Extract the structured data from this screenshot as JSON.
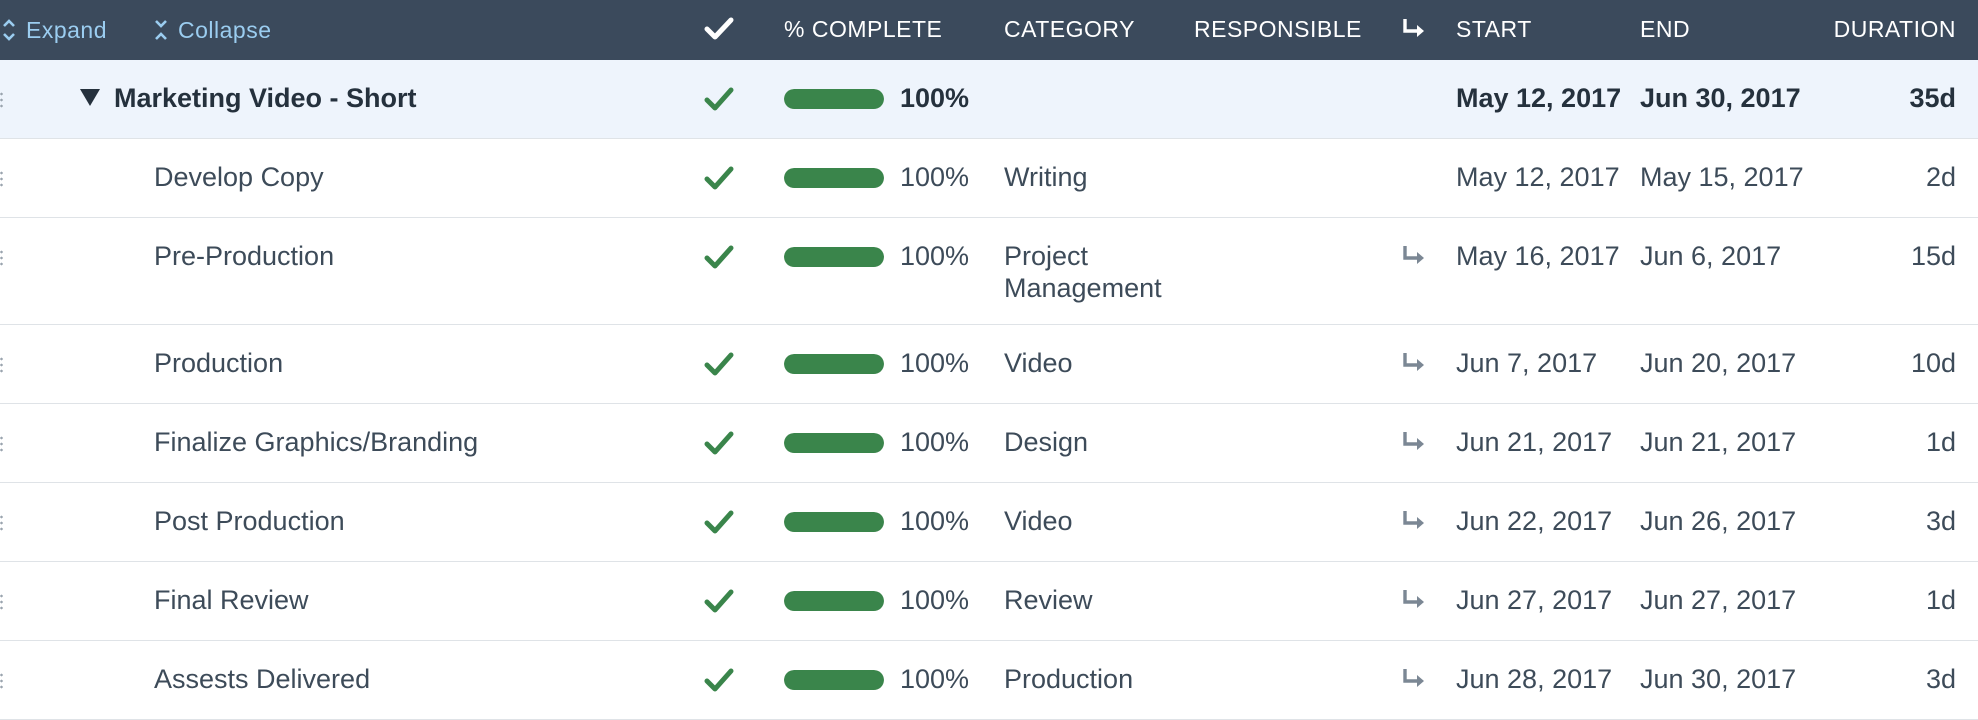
{
  "toolbar": {
    "expand_label": "Expand",
    "collapse_label": "Collapse"
  },
  "columns": {
    "complete": "% COMPLETE",
    "category": "CATEGORY",
    "responsible": "RESPONSIBLE",
    "start": "START",
    "end": "END",
    "duration": "DURATION"
  },
  "icons": {
    "done_check": "check-icon",
    "dependency": "dependency-arrow-icon",
    "expand": "expand-icon",
    "collapse": "collapse-icon",
    "caret": "caret-down-icon"
  },
  "colors": {
    "header_bg": "#3b4a5c",
    "header_link": "#9bcdf0",
    "progress_fill": "#3a854b",
    "check": "#3a854b",
    "parent_row_bg": "#eef4fc"
  },
  "rows": [
    {
      "name": "Marketing Video - Short",
      "parent": true,
      "progress": 100,
      "percent_label": "100%",
      "category": "",
      "dependency": false,
      "start": "May 12, 2017",
      "end": "Jun 30, 2017",
      "duration": "35d"
    },
    {
      "name": "Develop Copy",
      "parent": false,
      "progress": 100,
      "percent_label": "100%",
      "category": "Writing",
      "dependency": false,
      "start": "May 12, 2017",
      "end": "May 15, 2017",
      "duration": "2d"
    },
    {
      "name": "Pre-Production",
      "parent": false,
      "progress": 100,
      "percent_label": "100%",
      "category": "Project Management",
      "dependency": true,
      "start": "May 16, 2017",
      "end": "Jun 6, 2017",
      "duration": "15d"
    },
    {
      "name": "Production",
      "parent": false,
      "progress": 100,
      "percent_label": "100%",
      "category": "Video",
      "dependency": true,
      "start": "Jun 7, 2017",
      "end": "Jun 20, 2017",
      "duration": "10d"
    },
    {
      "name": "Finalize Graphics/Branding",
      "parent": false,
      "progress": 100,
      "percent_label": "100%",
      "category": "Design",
      "dependency": true,
      "start": "Jun 21, 2017",
      "end": "Jun 21, 2017",
      "duration": "1d"
    },
    {
      "name": "Post Production",
      "parent": false,
      "progress": 100,
      "percent_label": "100%",
      "category": "Video",
      "dependency": true,
      "start": "Jun 22, 2017",
      "end": "Jun 26, 2017",
      "duration": "3d"
    },
    {
      "name": "Final Review",
      "parent": false,
      "progress": 100,
      "percent_label": "100%",
      "category": "Review",
      "dependency": true,
      "start": "Jun 27, 2017",
      "end": "Jun 27, 2017",
      "duration": "1d"
    },
    {
      "name": "Assests Delivered",
      "parent": false,
      "progress": 100,
      "percent_label": "100%",
      "category": "Production",
      "dependency": true,
      "start": "Jun 28, 2017",
      "end": "Jun 30, 2017",
      "duration": "3d"
    }
  ]
}
